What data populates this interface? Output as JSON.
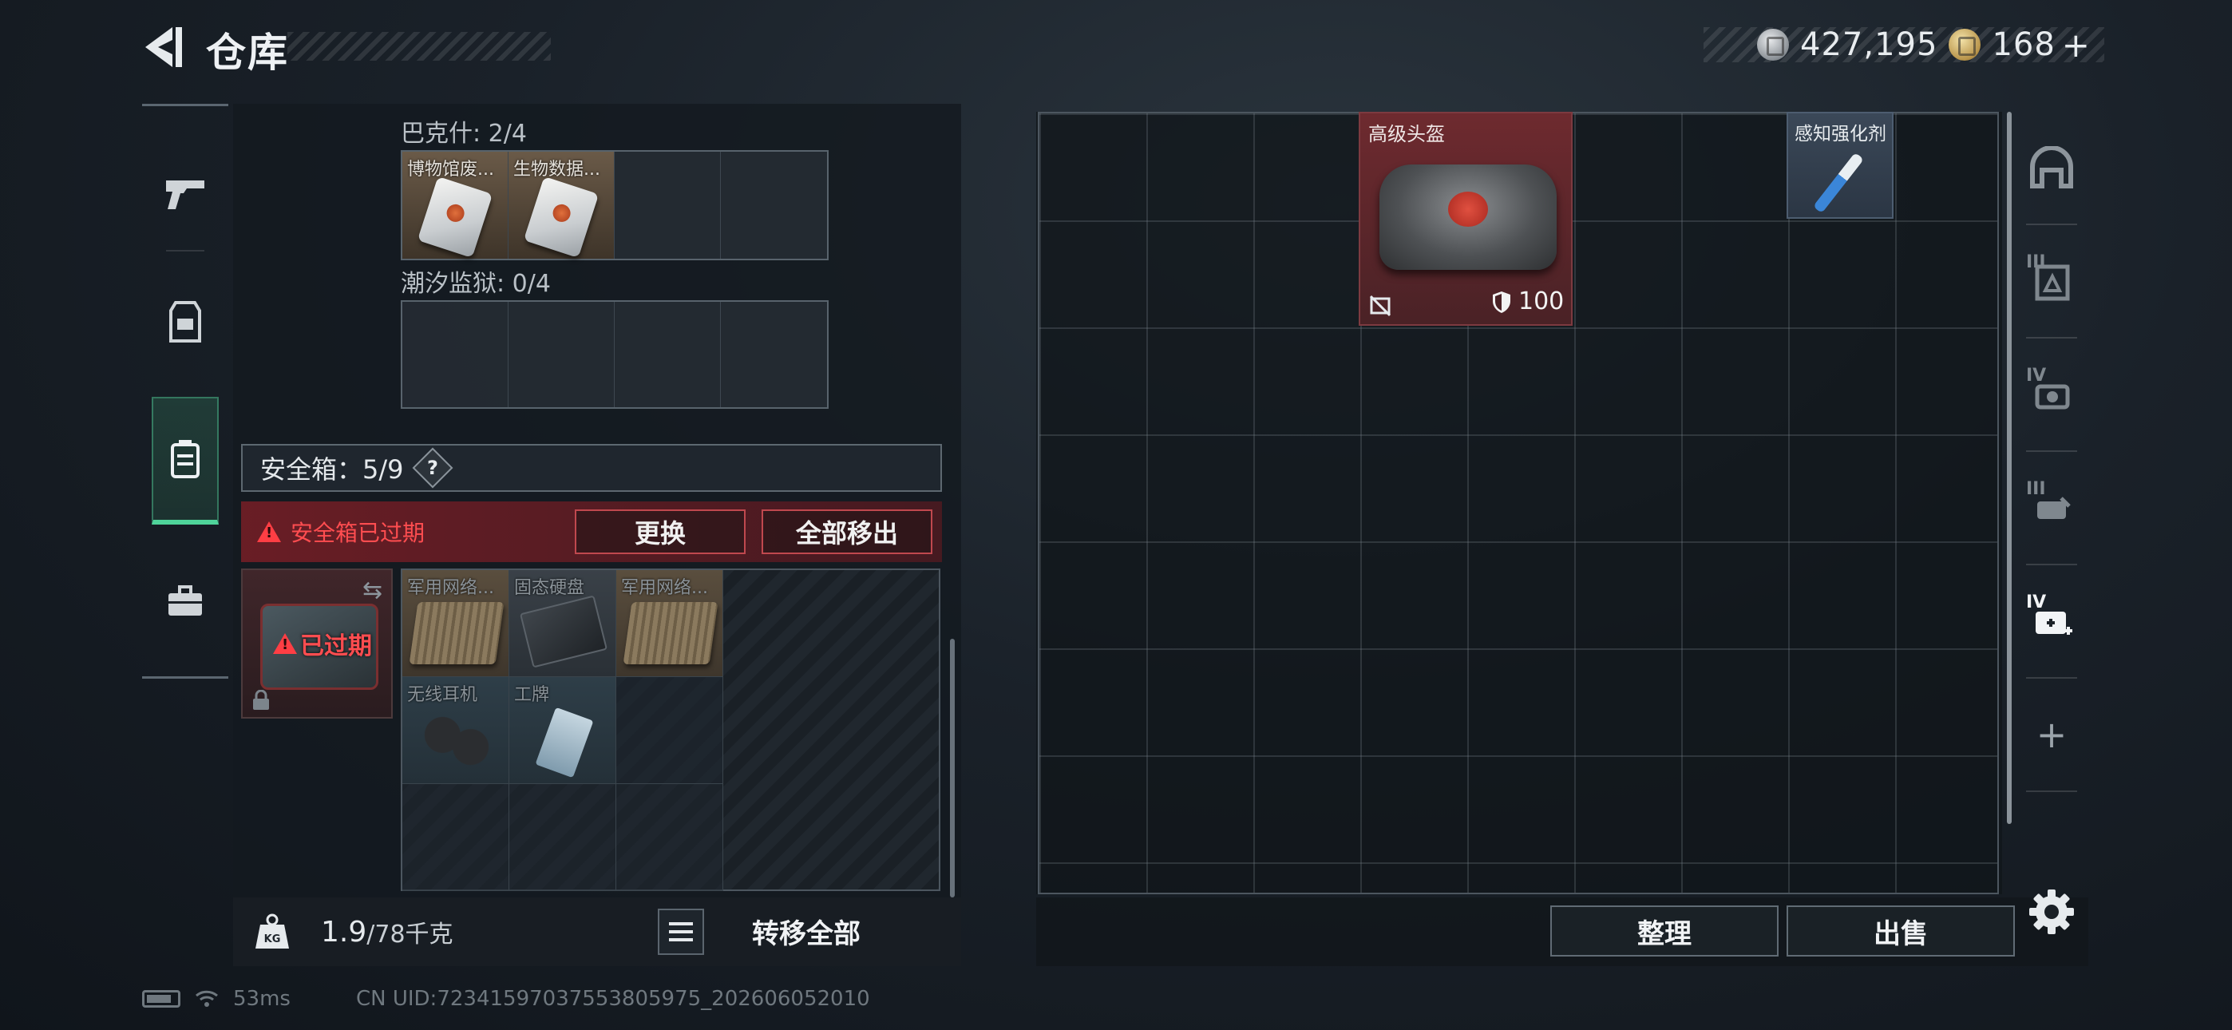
{
  "header": {
    "title": "仓库",
    "currency": [
      {
        "icon": "silver-coin-icon",
        "value": "427,195"
      },
      {
        "icon": "gold-coin-icon",
        "value": "168"
      }
    ],
    "plus": "+"
  },
  "left_rail": {
    "items": [
      {
        "icon": "pistol-icon",
        "active": false
      },
      {
        "icon": "vest-icon",
        "active": false
      },
      {
        "icon": "backpack-icon",
        "active": true
      },
      {
        "icon": "toolbox-icon",
        "active": false
      }
    ]
  },
  "collections": [
    {
      "label": "巴克什: 2/4",
      "items": [
        "博物馆废...",
        "生物数据..."
      ],
      "slots": 4
    },
    {
      "label": "潮汐监狱: 0/4",
      "items": [],
      "slots": 4
    }
  ],
  "safebox": {
    "label": "安全箱：5/9",
    "help": "?",
    "expired_message": "安全箱已过期",
    "replace_label": "更换",
    "move_all_label": "全部移出",
    "expired_stamp": "已过期",
    "items": [
      "军用网络...",
      "固态硬盘",
      "军用网络...",
      "无线耳机",
      "工牌"
    ]
  },
  "weight": {
    "current": "1.9",
    "max": "/78千克"
  },
  "transfer_all_label": "转移全部",
  "stash": {
    "helmet": {
      "name": "高级头盔",
      "durability": "100"
    },
    "injector": {
      "name": "感知强化剂"
    }
  },
  "right_rail": {
    "items": [
      {
        "icon": "helmet-icon",
        "tier": ""
      },
      {
        "icon": "armor-icon",
        "tier": "III"
      },
      {
        "icon": "gear-tier-icon",
        "tier": "IV"
      },
      {
        "icon": "tool-icon",
        "tier": "III"
      },
      {
        "icon": "medkit-icon",
        "tier": "IV"
      }
    ],
    "plus_label": "+"
  },
  "actions": {
    "sort_label": "整理",
    "sell_label": "出售"
  },
  "status": {
    "ping": "53ms",
    "uid": "CN UID:72341597037553805975_202606052010"
  }
}
